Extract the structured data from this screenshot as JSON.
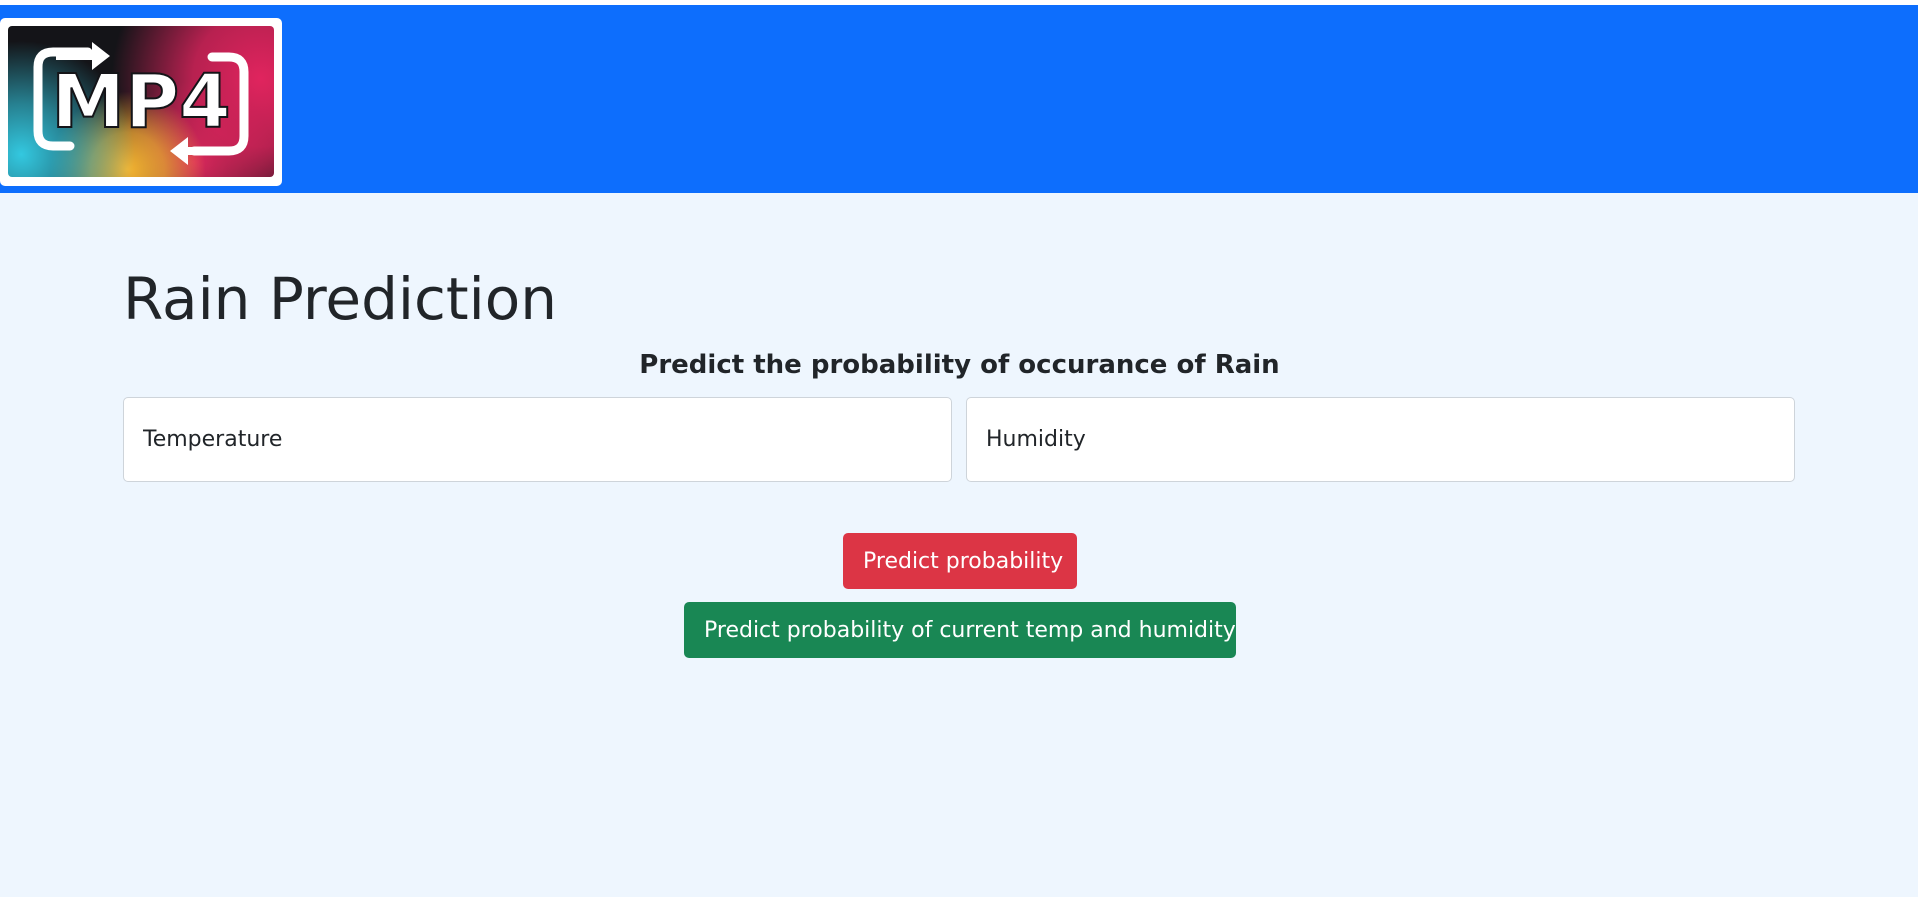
{
  "header": {
    "logo_text": "MP4",
    "logo_icon": "mp4-convert-logo"
  },
  "main": {
    "title": "Rain Prediction",
    "subtitle": "Predict the probability of occurance of Rain",
    "temperature_placeholder": "Temperature",
    "humidity_placeholder": "Humidity",
    "predict_button": "Predict probability",
    "predict_current_button": "Predict probability of current temp and humidity"
  },
  "colors": {
    "navbar": "#0d6efd",
    "background": "#eef6fe",
    "danger": "#dc3545",
    "success": "#198754"
  }
}
